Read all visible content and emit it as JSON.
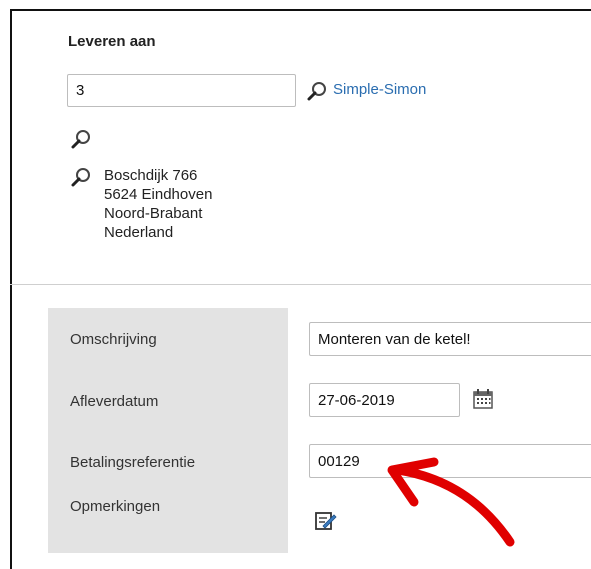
{
  "delivery": {
    "title": "Leveren aan",
    "code_value": "3",
    "customer_name": "Simple-Simon",
    "address_lines": [
      "Boschdijk 766",
      "5624 Eindhoven",
      "Noord-Brabant",
      "Nederland"
    ]
  },
  "form": {
    "omschrijving_label": "Omschrijving",
    "omschrijving_value": "Monteren van de ketel!",
    "afleverdatum_label": "Afleverdatum",
    "afleverdatum_value": "27-06-2019",
    "betalingsreferentie_label": "Betalingsreferentie",
    "betalingsreferentie_value": "00129",
    "opmerkingen_label": "Opmerkingen"
  },
  "colors": {
    "link": "#2a6db0",
    "panel": "#e3e3e3",
    "annotation_arrow": "#e00000"
  },
  "icons": {
    "lookup": "magnifier-icon",
    "calendar": "calendar-icon",
    "edit": "edit-note-icon"
  }
}
